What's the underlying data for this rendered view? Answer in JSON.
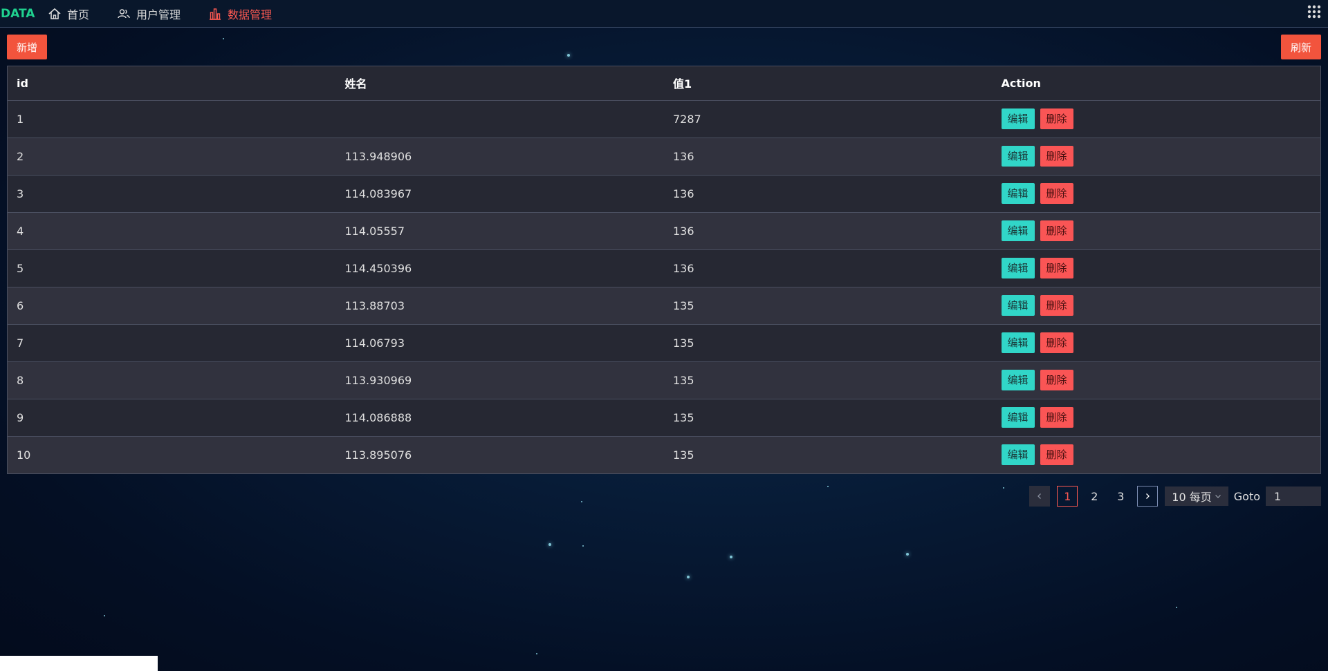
{
  "header": {
    "logo": "DATA",
    "nav": [
      {
        "label": "首页",
        "icon": "home-icon",
        "active": false
      },
      {
        "label": "用户管理",
        "icon": "users-icon",
        "active": false
      },
      {
        "label": "数据管理",
        "icon": "bar-chart-icon",
        "active": true
      }
    ],
    "menu_icon": "grid-menu-icon"
  },
  "toolbar": {
    "add_label": "新增",
    "refresh_label": "刷新"
  },
  "table": {
    "columns": [
      "id",
      "姓名",
      "值1",
      "Action"
    ],
    "rows": [
      {
        "id": "1",
        "name": "",
        "value": "7287"
      },
      {
        "id": "2",
        "name": "113.948906",
        "value": "136"
      },
      {
        "id": "3",
        "name": "114.083967",
        "value": "136"
      },
      {
        "id": "4",
        "name": "114.05557",
        "value": "136"
      },
      {
        "id": "5",
        "name": "114.450396",
        "value": "136"
      },
      {
        "id": "6",
        "name": "113.88703",
        "value": "135"
      },
      {
        "id": "7",
        "name": "114.06793",
        "value": "135"
      },
      {
        "id": "8",
        "name": "113.930969",
        "value": "135"
      },
      {
        "id": "9",
        "name": "114.086888",
        "value": "135"
      },
      {
        "id": "10",
        "name": "113.895076",
        "value": "135"
      }
    ],
    "edit_label": "编辑",
    "delete_label": "删除"
  },
  "pagination": {
    "pages": [
      "1",
      "2",
      "3"
    ],
    "current": "1",
    "page_size_label": "10 每页",
    "goto_label": "Goto",
    "goto_value": "1"
  },
  "colors": {
    "accent": "#ff5a52",
    "logo": "#1fd18f",
    "orange_button": "#f2543d",
    "edit_button": "#31d6c8",
    "delete_button": "#fa5555"
  }
}
